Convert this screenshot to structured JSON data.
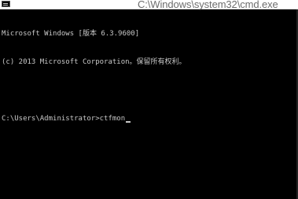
{
  "window": {
    "title": "C:\\Windows\\system32\\cmd.exe",
    "icon": "cmd-icon"
  },
  "console": {
    "lines": [
      "Microsoft Windows [版本 6.3.9600]",
      "(c) 2013 Microsoft Corporation。保留所有权利。"
    ],
    "prompt": "C:\\Users\\Administrator>",
    "command": "ctfmon"
  },
  "colors": {
    "background": "#000000",
    "text": "#c8c8c8",
    "title_text": "#6d6d6d"
  }
}
